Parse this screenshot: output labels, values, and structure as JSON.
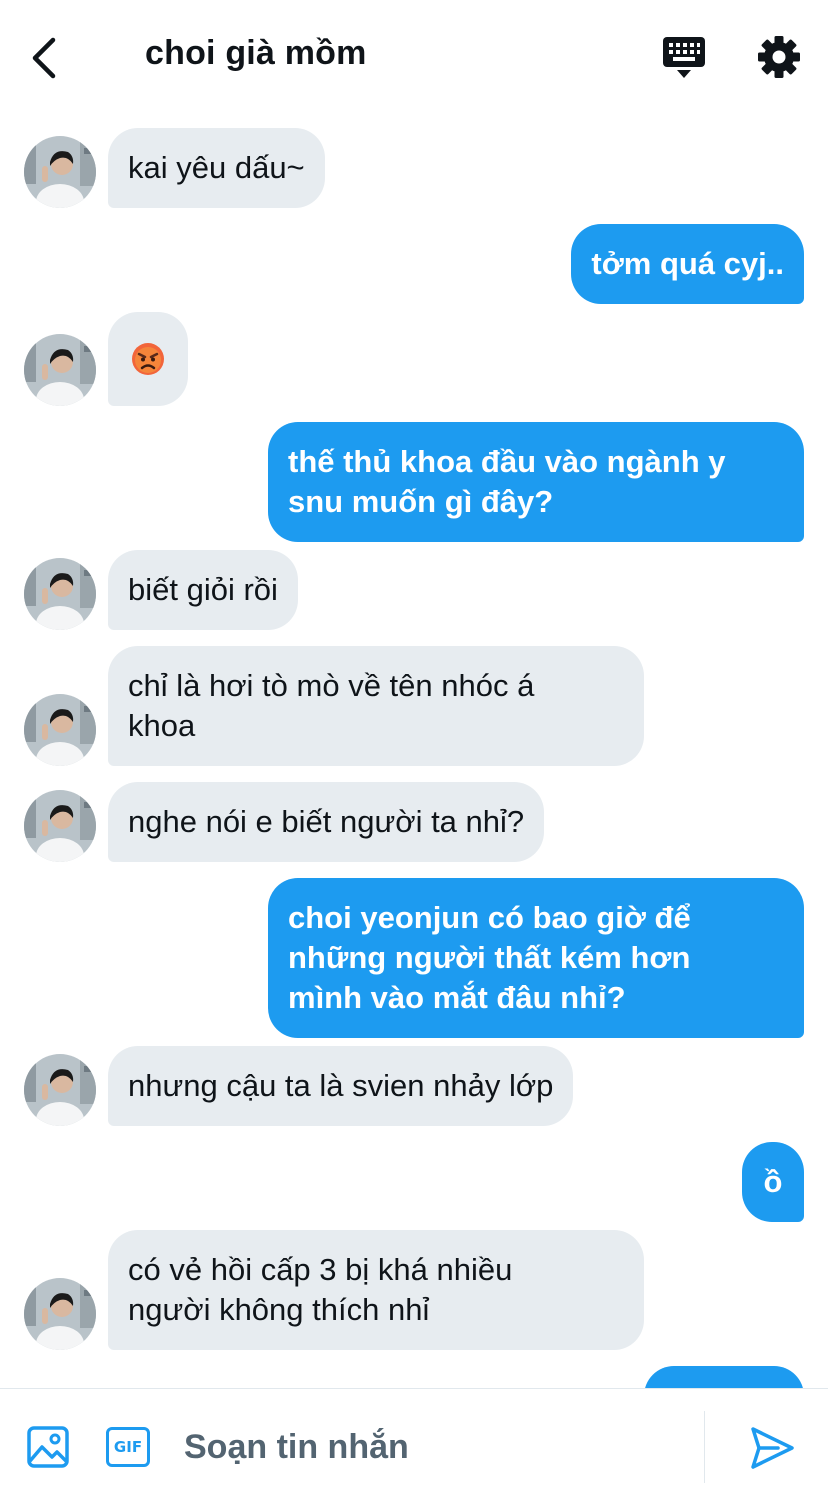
{
  "header": {
    "title": "choi già mồm"
  },
  "colors": {
    "accent": "#1d9bf0",
    "incoming_bubble": "#e7ecf0",
    "text": "#0f1419",
    "muted": "#536471"
  },
  "icons": {
    "back": "chevron-left-icon",
    "keyboard": "keyboard-icon",
    "settings": "gear-icon",
    "media": "image-icon",
    "gif": "gif-icon",
    "send": "send-icon"
  },
  "messages": [
    {
      "from": "them",
      "text": "kai yêu dấu~"
    },
    {
      "from": "me",
      "text": "tởm quá cyj.."
    },
    {
      "from": "them",
      "text": "😡"
    },
    {
      "from": "me",
      "lines": [
        "thế thủ khoa đầu vào ngành y",
        "snu muốn gì đây?"
      ]
    },
    {
      "from": "them",
      "text": "biết giỏi rồi"
    },
    {
      "from": "them",
      "lines": [
        "chỉ là hơi tò mò về tên nhóc á",
        "khoa"
      ]
    },
    {
      "from": "them",
      "text": "nghe nói e biết người ta nhỉ?"
    },
    {
      "from": "me",
      "lines": [
        "choi yeonjun có bao giờ để",
        "những người thất kém hơn",
        "mình vào mắt đâu nhỉ?"
      ]
    },
    {
      "from": "them",
      "text": "nhưng cậu ta là svien nhảy lớp"
    },
    {
      "from": "me",
      "text": "ồ"
    },
    {
      "from": "them",
      "lines": [
        "có vẻ hồi cấp 3 bị khá nhiều",
        "người không thích nhỉ"
      ]
    }
  ],
  "composer": {
    "gif_label": "GIF",
    "placeholder": "Soạn tin nhắn"
  }
}
